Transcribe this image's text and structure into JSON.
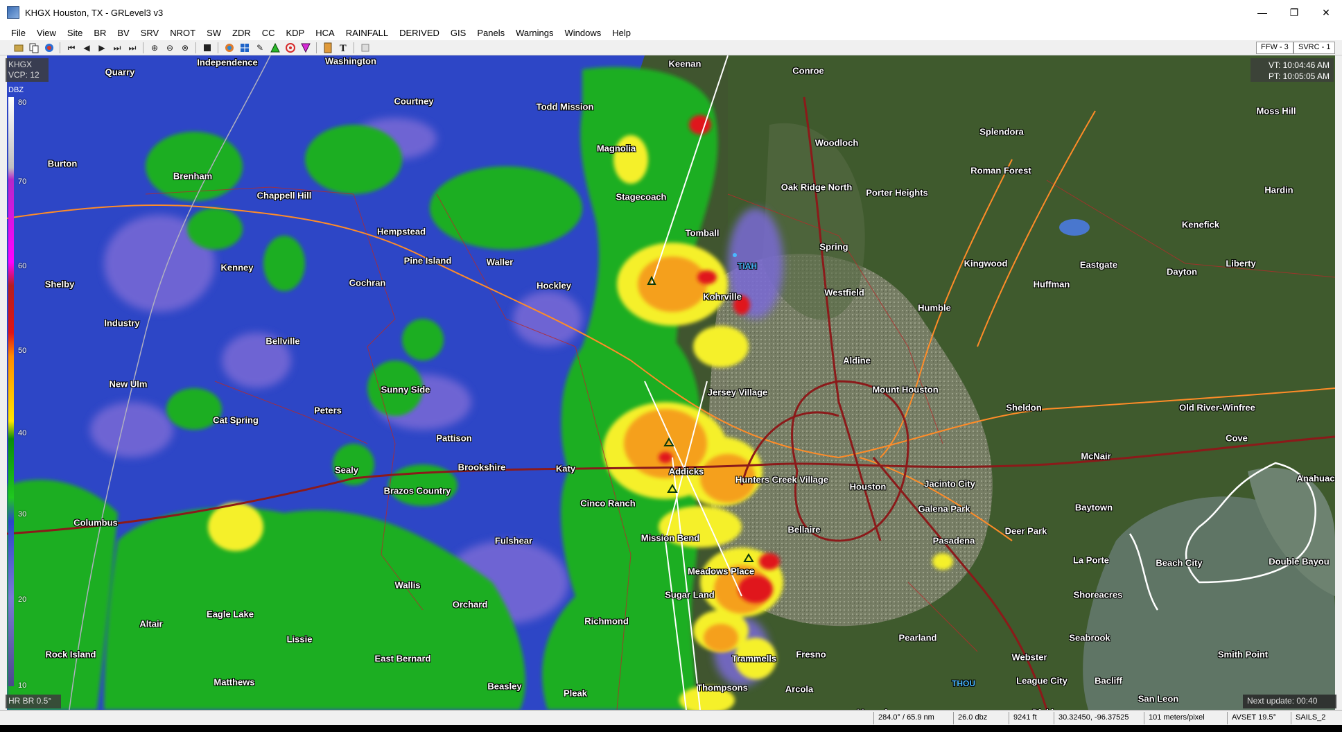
{
  "window": {
    "title": "KHGX Houston, TX - GRLevel3 v3"
  },
  "titlebar_buttons": {
    "minimize": "—",
    "maximize": "❐",
    "close": "✕"
  },
  "menu": [
    "File",
    "View",
    "Site",
    "BR",
    "BV",
    "SRV",
    "NROT",
    "SW",
    "ZDR",
    "CC",
    "KDP",
    "HCA",
    "RAINFALL",
    "DERIVED",
    "GIS",
    "Panels",
    "Warnings",
    "Windows",
    "Help"
  ],
  "toolbar": {
    "ffw": "FFW - 3",
    "svrc": "SVRC - 1"
  },
  "overlay": {
    "site": "KHGX",
    "vcp": "VCP: 12",
    "dbz_label": "DBZ",
    "colorbar_ticks": [
      "80",
      "70",
      "60",
      "50",
      "40",
      "30",
      "20",
      "10"
    ],
    "vt": "VT: 10:04:46 AM",
    "pt": "PT: 10:05:05 AM",
    "product": "HR BR 0.5°",
    "next_update": "Next update: 00:40"
  },
  "places": [
    {
      "name": "Quarry"
    },
    {
      "name": "Independence"
    },
    {
      "name": "Washington"
    },
    {
      "name": "Keenan"
    },
    {
      "name": "Conroe"
    },
    {
      "name": "Moss Hill"
    },
    {
      "name": "Courtney"
    },
    {
      "name": "Todd Mission"
    },
    {
      "name": "Magnolia"
    },
    {
      "name": "Woodloch"
    },
    {
      "name": "Splendora"
    },
    {
      "name": "Burton"
    },
    {
      "name": "Brenham"
    },
    {
      "name": "Chappell Hill"
    },
    {
      "name": "Stagecoach"
    },
    {
      "name": "Oak Ridge North"
    },
    {
      "name": "Porter Heights"
    },
    {
      "name": "Roman Forest"
    },
    {
      "name": "Hardin"
    },
    {
      "name": "Hempstead"
    },
    {
      "name": "Tomball"
    },
    {
      "name": "Kenefick"
    },
    {
      "name": "Spring"
    },
    {
      "name": "Pine Island"
    },
    {
      "name": "Waller"
    },
    {
      "name": "Kenney"
    },
    {
      "name": "Kingwood"
    },
    {
      "name": "Eastgate"
    },
    {
      "name": "Dayton"
    },
    {
      "name": "Liberty"
    },
    {
      "name": "Shelby"
    },
    {
      "name": "Cochran"
    },
    {
      "name": "Hockley"
    },
    {
      "name": "Huffman"
    },
    {
      "name": "Westfield"
    },
    {
      "name": "Kohrville"
    },
    {
      "name": "Humble"
    },
    {
      "name": "Industry"
    },
    {
      "name": "Bellville"
    },
    {
      "name": "Aldine"
    },
    {
      "name": "New Ulm"
    },
    {
      "name": "Sunny Side"
    },
    {
      "name": "Mount Houston"
    },
    {
      "name": "Jersey Village"
    },
    {
      "name": "Sheldon"
    },
    {
      "name": "Old River-Winfree"
    },
    {
      "name": "Peters"
    },
    {
      "name": "Cat Spring"
    },
    {
      "name": "Pattison"
    },
    {
      "name": "Cove"
    },
    {
      "name": "Sealy"
    },
    {
      "name": "Brookshire"
    },
    {
      "name": "Katy"
    },
    {
      "name": "Addicks"
    },
    {
      "name": "McNair"
    },
    {
      "name": "Hunters Creek Village"
    },
    {
      "name": "Houston"
    },
    {
      "name": "Jacinto City"
    },
    {
      "name": "Anahuac"
    },
    {
      "name": "Brazos Country"
    },
    {
      "name": "Galena Park"
    },
    {
      "name": "Baytown"
    },
    {
      "name": "Cinco Ranch"
    },
    {
      "name": "Columbus"
    },
    {
      "name": "Bellaire"
    },
    {
      "name": "Deer Park"
    },
    {
      "name": "Fulshear"
    },
    {
      "name": "Mission Bend"
    },
    {
      "name": "Pasadena"
    },
    {
      "name": "La Porte"
    },
    {
      "name": "Beach City"
    },
    {
      "name": "Double Bayou"
    },
    {
      "name": "Meadows Place"
    },
    {
      "name": "Wallis"
    },
    {
      "name": "Sugar Land"
    },
    {
      "name": "Shoreacres"
    },
    {
      "name": "Orchard"
    },
    {
      "name": "Eagle Lake"
    },
    {
      "name": "Altair"
    },
    {
      "name": "Richmond"
    },
    {
      "name": "Pearland"
    },
    {
      "name": "Seabrook"
    },
    {
      "name": "Lissie"
    },
    {
      "name": "Rock Island"
    },
    {
      "name": "Fresno"
    },
    {
      "name": "Webster"
    },
    {
      "name": "Smith Point"
    },
    {
      "name": "East Bernard"
    },
    {
      "name": "Trammells"
    },
    {
      "name": "Matthews"
    },
    {
      "name": "League City"
    },
    {
      "name": "Bacliff"
    },
    {
      "name": "Beasley"
    },
    {
      "name": "Thompsons"
    },
    {
      "name": "Arcola"
    },
    {
      "name": "Pleak"
    },
    {
      "name": "San Leon"
    },
    {
      "name": "Manvel"
    },
    {
      "name": "Dickinson"
    }
  ],
  "airports": [
    {
      "name": "TIAH"
    },
    {
      "name": "THOU"
    }
  ],
  "status": {
    "azimuth": "284.0° / 65.9 nm",
    "value": "26.0 dbz",
    "height": "9241 ft",
    "latlon": "30.32450, -96.37525",
    "scale": "101 meters/pixel",
    "avset": "AVSET 19.5°",
    "sails": "SAILS_2"
  }
}
